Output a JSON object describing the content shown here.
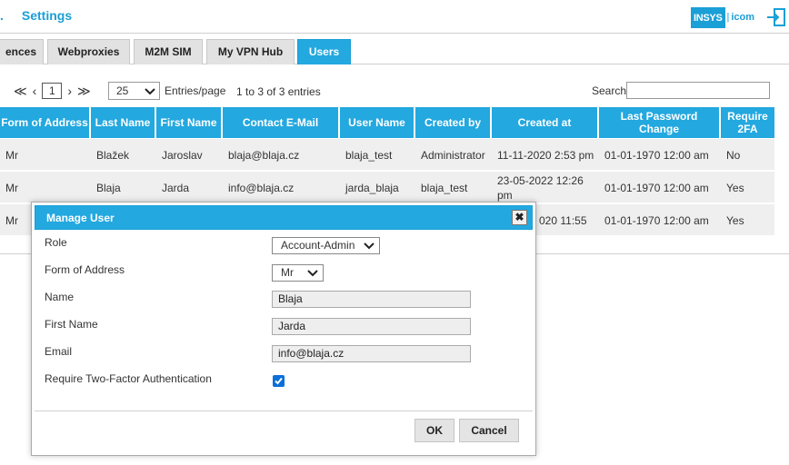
{
  "header": {
    "breadcrumb_prefix": ".",
    "title": "Settings",
    "logo_brand": "INSYS",
    "logo_suffix": "icom"
  },
  "tabs": [
    {
      "label": "ences"
    },
    {
      "label": "Webproxies"
    },
    {
      "label": "M2M SIM"
    },
    {
      "label": "My VPN Hub"
    },
    {
      "label": "Users"
    }
  ],
  "toolbar": {
    "first": "≪",
    "prev": "‹",
    "page": "1",
    "next": "›",
    "last": "≫",
    "per_page": "25",
    "per_page_label": "Entries/page",
    "range": "1 to 3 of 3 entries",
    "search_label": "Search",
    "search_value": ""
  },
  "table": {
    "columns": [
      "Form of Address",
      "Last Name",
      "First Name",
      "Contact E-Mail",
      "User Name",
      "Created by",
      "Created at",
      "Last Password Change",
      "Require 2FA"
    ],
    "rows": [
      [
        "Mr",
        "Blažek",
        "Jaroslav",
        "blaja@blaja.cz",
        "blaja_test",
        "Administrator",
        "11-11-2020 2:53 pm",
        "01-01-1970 12:00 am",
        "No"
      ],
      [
        "Mr",
        "Blaja",
        "Jarda",
        "info@blaja.cz",
        "jarda_blaja",
        "blaja_test",
        "23-05-2022 12:26 pm",
        "01-01-1970 12:00 am",
        "Yes"
      ],
      [
        "Mr",
        "",
        "",
        "",
        "",
        "",
        "020 11:55",
        "01-01-1970 12:00 am",
        "Yes"
      ]
    ]
  },
  "modal": {
    "title": "Manage User",
    "close": "✖",
    "role_label": "Role",
    "role_value": "Account-Admin",
    "address_label": "Form of Address",
    "address_value": "Mr",
    "name_label": "Name",
    "name_value": "Blaja",
    "firstname_label": "First Name",
    "firstname_value": "Jarda",
    "email_label": "Email",
    "email_value": "info@blaja.cz",
    "twofa_label": "Require Two-Factor Authentication",
    "twofa_checked": true,
    "ok_label": "OK",
    "cancel_label": "Cancel"
  },
  "colors": {
    "accent": "#23a8df",
    "accent_dark": "#1a9fd6",
    "row_bg": "#efefef",
    "checkbox": "#0a6fd8"
  }
}
